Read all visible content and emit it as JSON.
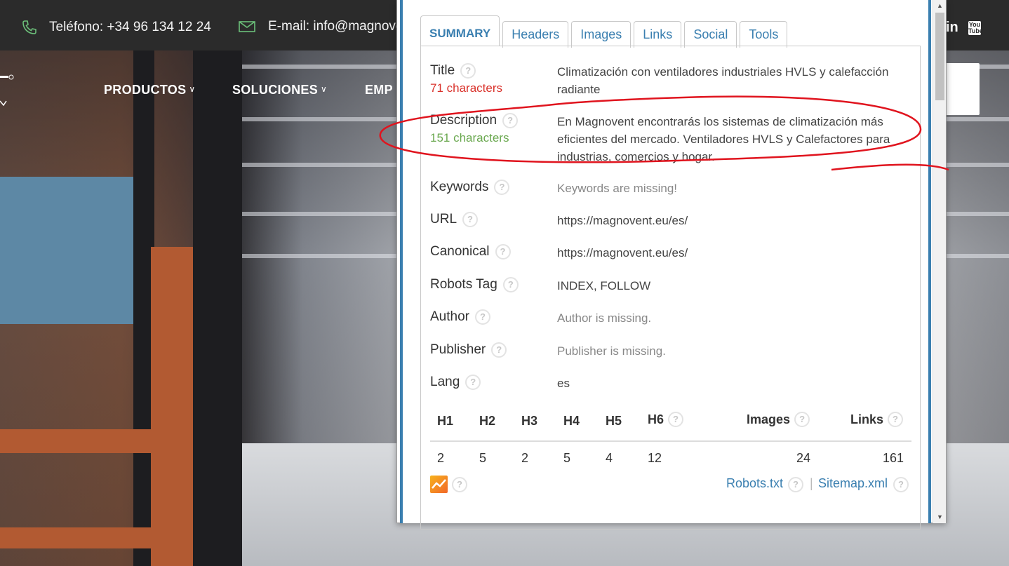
{
  "site": {
    "phone": "Teléfono: +34 96 134 12 24",
    "email": "E-mail: info@magnove",
    "nav": [
      "PRODUCTOS",
      "SOLUCIONES",
      "EMP"
    ],
    "social_in": "in",
    "social_yt": "You Tube"
  },
  "popup": {
    "tabs": [
      {
        "label": "SUMMARY",
        "active": true
      },
      {
        "label": "Headers"
      },
      {
        "label": "Images"
      },
      {
        "label": "Links"
      },
      {
        "label": "Social"
      },
      {
        "label": "Tools"
      }
    ],
    "rows": [
      {
        "label": "Title",
        "sub": "71 characters",
        "value": "Climatización con ventiladores industriales HVLS y calefacción radiante"
      },
      {
        "label": "Description",
        "sub": "151 characters",
        "value": "En Magnovent encontrarás los sistemas de climatización más eficientes del mercado. Ventiladores HVLS y Calefactores para industrias, comercios y hogar."
      },
      {
        "label": "Keywords",
        "value": "Keywords are missing!"
      },
      {
        "label": "URL",
        "value": "https://magnovent.eu/es/"
      },
      {
        "label": "Canonical",
        "value": "https://magnovent.eu/es/"
      },
      {
        "label": "Robots Tag",
        "value": "INDEX, FOLLOW"
      },
      {
        "label": "Author",
        "value": "Author is missing."
      },
      {
        "label": "Publisher",
        "value": "Publisher is missing."
      },
      {
        "label": "Lang",
        "value": "es"
      }
    ],
    "stats": {
      "headers": [
        "H1",
        "H2",
        "H3",
        "H4",
        "H5",
        "H6",
        "Images",
        "Links"
      ],
      "values": [
        "2",
        "5",
        "2",
        "5",
        "4",
        "12",
        "24",
        "161"
      ]
    },
    "footer": {
      "robots": "Robots.txt",
      "separator": "|",
      "sitemap": "Sitemap.xml"
    },
    "help_glyph": "?"
  },
  "colors": {
    "accent": "#3a7fb0",
    "red": "#d9312a",
    "green": "#6aa84f",
    "annotation": "#e0141e"
  }
}
